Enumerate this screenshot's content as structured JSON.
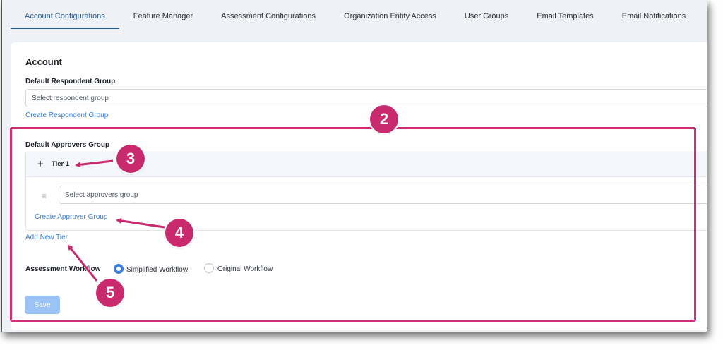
{
  "tabs": [
    {
      "label": "Account Configurations",
      "active": true
    },
    {
      "label": "Feature Manager"
    },
    {
      "label": "Assessment Configurations"
    },
    {
      "label": "Organization Entity Access"
    },
    {
      "label": "User Groups"
    },
    {
      "label": "Email Templates"
    },
    {
      "label": "Email Notifications"
    }
  ],
  "account": {
    "title": "Account",
    "respondent": {
      "label": "Default Respondent Group",
      "placeholder": "Select respondent group",
      "create_link": "Create Respondent Group"
    },
    "approvers": {
      "label": "Default Approvers Group",
      "tier_label": "Tier 1",
      "placeholder": "Select approvers group",
      "create_link": "Create Approver Group",
      "add_tier_link": "Add New Tier"
    },
    "workflow": {
      "label": "Assessment Workflow",
      "options": [
        {
          "label": "Simplified Workflow",
          "selected": true
        },
        {
          "label": "Original Workflow",
          "selected": false
        }
      ]
    },
    "save_label": "Save"
  },
  "annotations": {
    "callouts": [
      "2",
      "3",
      "4",
      "5"
    ],
    "color": "#c92a6e"
  },
  "colors": {
    "accent": "#3b7fd9",
    "active_tab": "#2a5a8e",
    "save_disabled": "#9cc3f5"
  }
}
